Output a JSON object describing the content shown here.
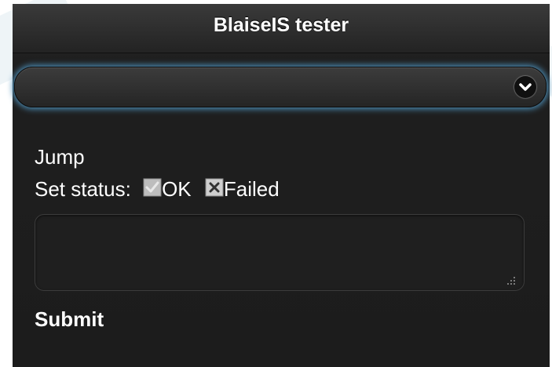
{
  "header": {
    "title": "BlaiseIS tester"
  },
  "select": {
    "value": "",
    "icon": "chevron-down-icon"
  },
  "links": {
    "jump": "Jump",
    "submit": "Submit"
  },
  "status": {
    "label": "Set status:",
    "ok_label": "OK",
    "ok_icon": "check-icon",
    "failed_label": "Failed",
    "failed_icon": "x-icon"
  },
  "textarea": {
    "value": "",
    "resize_icon": "resize-grip-icon"
  },
  "colors": {
    "background": "#1c1c1c",
    "header": "#2b2b2b",
    "text": "#ffffff",
    "focus_glow": "#4d8fb8"
  }
}
